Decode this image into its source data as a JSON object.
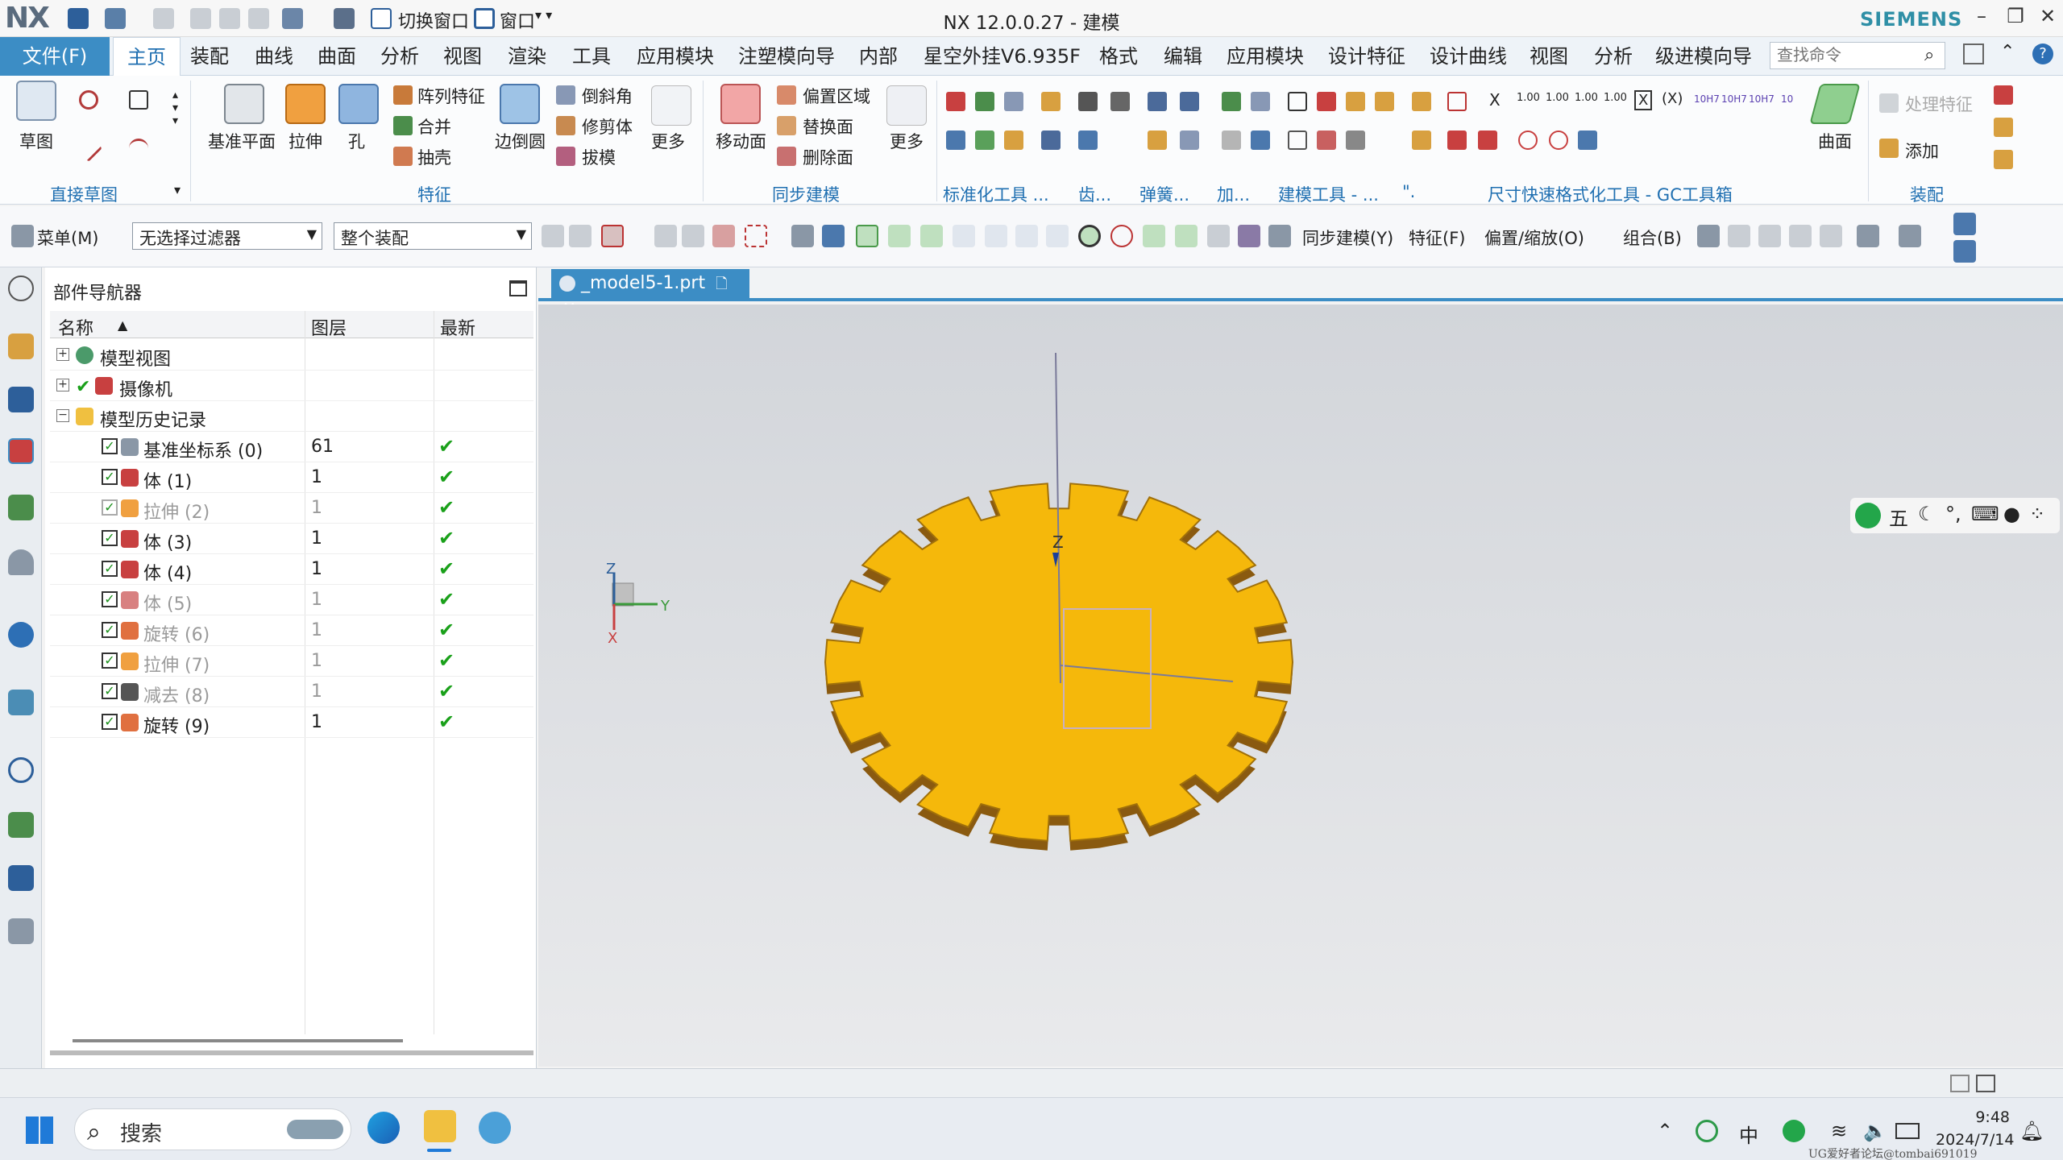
{
  "titlebar": {
    "logo": "NX",
    "switch_window": "切换窗口",
    "window": "窗口",
    "title": "NX 12.0.0.27 - 建模",
    "brand": "SIEMENS"
  },
  "menubar": {
    "file": "文件(F)",
    "tabs": [
      "主页",
      "装配",
      "曲线",
      "曲面",
      "分析",
      "视图",
      "渲染",
      "工具",
      "应用模块",
      "注塑模向导",
      "内部",
      "星空外挂V6.935F",
      "格式",
      "编辑",
      "应用模块",
      "设计特征",
      "设计曲线",
      "视图",
      "分析",
      "级进模向导"
    ],
    "search_placeholder": "查找命令"
  },
  "ribbon": {
    "sketch": "草图",
    "datum_plane": "基准平面",
    "extrude": "拉伸",
    "hole": "孔",
    "pattern_feature": "阵列特征",
    "unite": "合并",
    "shell": "抽壳",
    "edge_blend": "边倒圆",
    "chamfer": "倒斜角",
    "trim_body": "修剪体",
    "draft": "拔模",
    "more1": "更多",
    "move_face": "移动面",
    "offset_region": "偏置区域",
    "replace_face": "替换面",
    "delete_face": "删除面",
    "more2": "更多",
    "surface": "曲面",
    "process_feature": "处理特征",
    "add": "添加",
    "groups": {
      "direct_sketch": "直接草图",
      "feature": "特征",
      "sync_modeling": "同步建模",
      "std_tools": "标准化工具 ...",
      "gear": "齿...",
      "spring": "弹簧...",
      "add": "加...",
      "modeling_tools": "建模工具 - ...",
      "dot": "\".",
      "dim_format": "尺寸快速格式化工具 - GC工具箱",
      "assembly": "装配"
    },
    "dim_icons": [
      "X",
      "1.00",
      "1.00",
      "1.00",
      "1.00",
      "X",
      "(X)",
      "10H7",
      "10H7",
      "10H7",
      "10"
    ]
  },
  "toolbar2": {
    "menu": "菜单(M)",
    "filter": "无选择过滤器",
    "scope": "整个装配",
    "sync_modeling": "同步建模(Y)",
    "feature": "特征(F)",
    "offset_scale": "偏置/缩放(O)",
    "combine": "组合(B)"
  },
  "navigator": {
    "title": "部件导航器",
    "columns": {
      "name": "名称",
      "layer": "图层",
      "latest": "最新"
    },
    "tree": [
      {
        "label": "模型视图",
        "level": 0,
        "expander": "+"
      },
      {
        "label": "摄像机",
        "level": 0,
        "expander": "+"
      },
      {
        "label": "模型历史记录",
        "level": 0,
        "expander": "−"
      }
    ],
    "features": [
      {
        "name": "基准坐标系 (0)",
        "layer": "61",
        "latest": "✔",
        "grey": false,
        "icon": "datum-csys-icon"
      },
      {
        "name": "体 (1)",
        "layer": "1",
        "latest": "✔",
        "grey": false,
        "icon": "body-icon"
      },
      {
        "name": "拉伸 (2)",
        "layer": "1",
        "latest": "✔",
        "grey": true,
        "icon": "extrude-icon"
      },
      {
        "name": "体 (3)",
        "layer": "1",
        "latest": "✔",
        "grey": false,
        "icon": "body-icon"
      },
      {
        "name": "体 (4)",
        "layer": "1",
        "latest": "✔",
        "grey": false,
        "icon": "body-icon"
      },
      {
        "name": "体 (5)",
        "layer": "1",
        "latest": "✔",
        "grey": true,
        "icon": "body-icon"
      },
      {
        "name": "旋转 (6)",
        "layer": "1",
        "latest": "✔",
        "grey": true,
        "icon": "revolve-icon"
      },
      {
        "name": "拉伸 (7)",
        "layer": "1",
        "latest": "✔",
        "grey": true,
        "icon": "extrude-icon"
      },
      {
        "name": "减去 (8)",
        "layer": "1",
        "latest": "✔",
        "grey": true,
        "icon": "subtract-icon"
      },
      {
        "name": "旋转 (9)",
        "layer": "1",
        "latest": "✔",
        "grey": false,
        "icon": "revolve-icon"
      }
    ]
  },
  "viewport": {
    "file_tab": "_model5-1.prt",
    "part_color": "#f5b80b",
    "axis_labels": {
      "z": "Z",
      "y": "Y",
      "x": "X"
    },
    "ime": "五"
  },
  "taskbar": {
    "search": "搜索",
    "tray_ime": "中",
    "time": "9:48",
    "date": "2024/7/14"
  },
  "watermark": "UG爱好者论坛@tombai691019",
  "colors": {
    "accent": "#3c8dc5",
    "check": "#1aa01a",
    "gear": "#f5b80b"
  }
}
